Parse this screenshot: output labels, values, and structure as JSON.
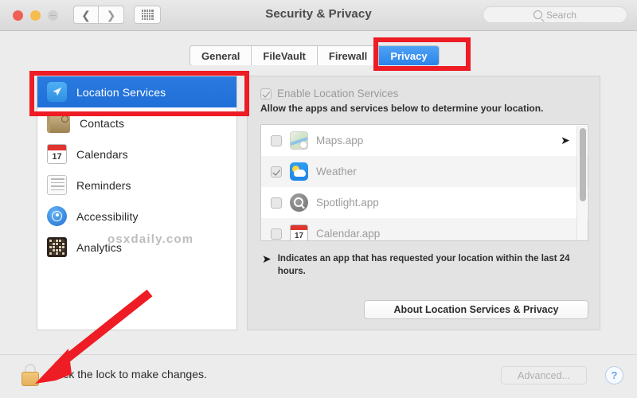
{
  "window": {
    "title": "Security & Privacy",
    "traffic_lights": [
      "close",
      "minimize",
      "zoom"
    ],
    "nav_back_icon": "chevron-left-icon",
    "nav_forward_icon": "chevron-right-icon",
    "show_all_icon": "grid-icon",
    "search": {
      "placeholder": "Search",
      "icon": "search-icon"
    }
  },
  "tabs": [
    {
      "label": "General",
      "active": false
    },
    {
      "label": "FileVault",
      "active": false
    },
    {
      "label": "Firewall",
      "active": false
    },
    {
      "label": "Privacy",
      "active": true
    }
  ],
  "sidebar": {
    "items": [
      {
        "label": "Location Services",
        "icon": "location-arrow-icon",
        "selected": true
      },
      {
        "label": "Contacts",
        "icon": "address-book-icon",
        "selected": false
      },
      {
        "label": "Calendars",
        "icon": "calendar-icon",
        "selected": false
      },
      {
        "label": "Reminders",
        "icon": "reminders-list-icon",
        "selected": false
      },
      {
        "label": "Accessibility",
        "icon": "accessibility-icon",
        "selected": false
      },
      {
        "label": "Analytics",
        "icon": "analytics-grid-icon",
        "selected": false
      }
    ],
    "watermark": "osxdaily.com"
  },
  "main": {
    "enable_checkbox": {
      "label": "Enable Location Services",
      "checked": true,
      "disabled": true
    },
    "description": "Allow the apps and services below to determine your location.",
    "app_list": [
      {
        "name": "Maps.app",
        "icon": "maps-icon",
        "checked": false,
        "recent_location": true
      },
      {
        "name": "Weather",
        "icon": "weather-icon",
        "checked": true,
        "recent_location": false
      },
      {
        "name": "Spotlight.app",
        "icon": "spotlight-icon",
        "checked": false,
        "recent_location": false
      },
      {
        "name": "Calendar.app",
        "icon": "calendar-icon",
        "checked": false,
        "recent_location": false
      }
    ],
    "calendar_day": "17",
    "footnote": "Indicates an app that has requested your location within the last 24 hours.",
    "footnote_icon": "location-arrow-icon",
    "about_button": "About Location Services & Privacy"
  },
  "bottom": {
    "lock_icon": "lock-closed-icon",
    "lock_text": "Click the lock to make changes.",
    "advanced_button": "Advanced...",
    "help_button": "?"
  },
  "annotations": {
    "accent_color": "#ee1c25",
    "boxes": [
      "privacy-tab",
      "location-services-row"
    ],
    "arrow_target": "lock-icon"
  }
}
